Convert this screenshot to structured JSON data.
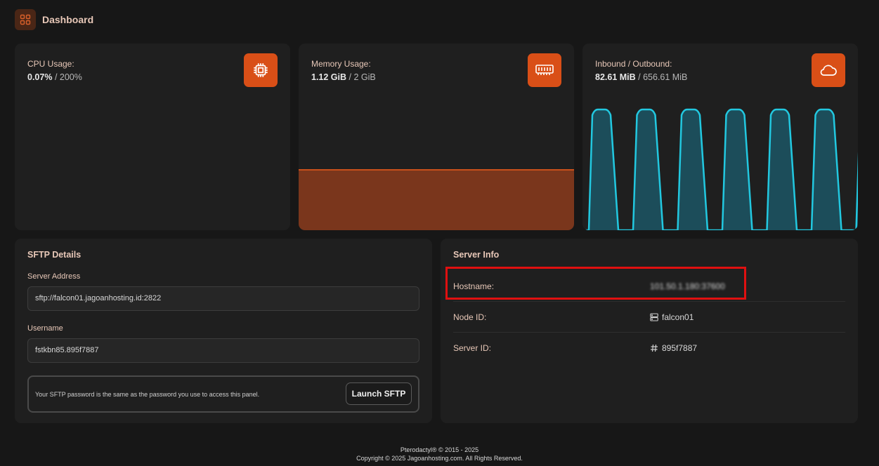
{
  "header": {
    "title": "Dashboard",
    "icon": "grid-icon"
  },
  "stats": {
    "cpu": {
      "label": "CPU Usage:",
      "value": "0.07%",
      "limit": "/ 200%",
      "icon": "cpu-chip-icon"
    },
    "memory": {
      "label": "Memory Usage:",
      "value": "1.12 GiB",
      "limit": "/ 2 GiB",
      "icon": "memory-ram-icon",
      "fill_fraction": 0.53
    },
    "network": {
      "label": "Inbound / Outbound:",
      "value": "82.61 MiB",
      "limit": "/ 656.61 MiB",
      "icon": "cloud-icon"
    }
  },
  "sftp": {
    "title": "SFTP Details",
    "address_label": "Server Address",
    "address_value": "sftp://falcon01.jagoanhosting.id:2822",
    "username_label": "Username",
    "username_value": "fstkbn85.895f7887",
    "notice": "Your SFTP password is the same as the password you use to access this panel.",
    "launch_label": "Launch SFTP"
  },
  "server_info": {
    "title": "Server Info",
    "rows": [
      {
        "key": "Hostname:",
        "value": "101.50.1.180:37600",
        "icon": ""
      },
      {
        "key": "Node ID:",
        "value": "falcon01",
        "icon": "server-icon"
      },
      {
        "key": "Server ID:",
        "value": "895f7887",
        "icon": "hash-icon"
      }
    ]
  },
  "footer": {
    "line1": "Pterodactyl® © 2015 - 2025",
    "line2": "Copyright © 2025 Jagoanhosting.com. All Rights Reserved."
  },
  "colors": {
    "accent": "#d94f17",
    "network_line": "#22c8e0",
    "highlight": "#e01010"
  }
}
